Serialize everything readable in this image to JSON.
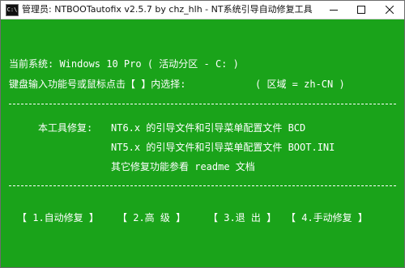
{
  "window": {
    "icon_text": "C:\\",
    "title": "管理员: NTBOOTautofix v2.5.7 by chz_hlh - NT系统引导自动修复工具"
  },
  "console": {
    "current_system": "当前系统: Windows 10 Pro  ( 活动分区 - C: )",
    "prompt": "键盘输入功能号或鼠标点击【 】内选择:",
    "locale": "( 区域 = zh-CN )",
    "tool_label": "本工具修复:",
    "fix_items": [
      "NT6.x 的引导文件和引导菜单配置文件 BCD",
      "NT5.x 的引导文件和引导菜单配置文件 BOOT.INI",
      "其它修复功能参看 readme 文档"
    ]
  },
  "menu": [
    {
      "label": "【 1.自动修复 】"
    },
    {
      "label": "【 2.高  级 】"
    },
    {
      "label": "【 3.退  出 】"
    },
    {
      "label": "【 4.手动修复 】"
    }
  ]
}
